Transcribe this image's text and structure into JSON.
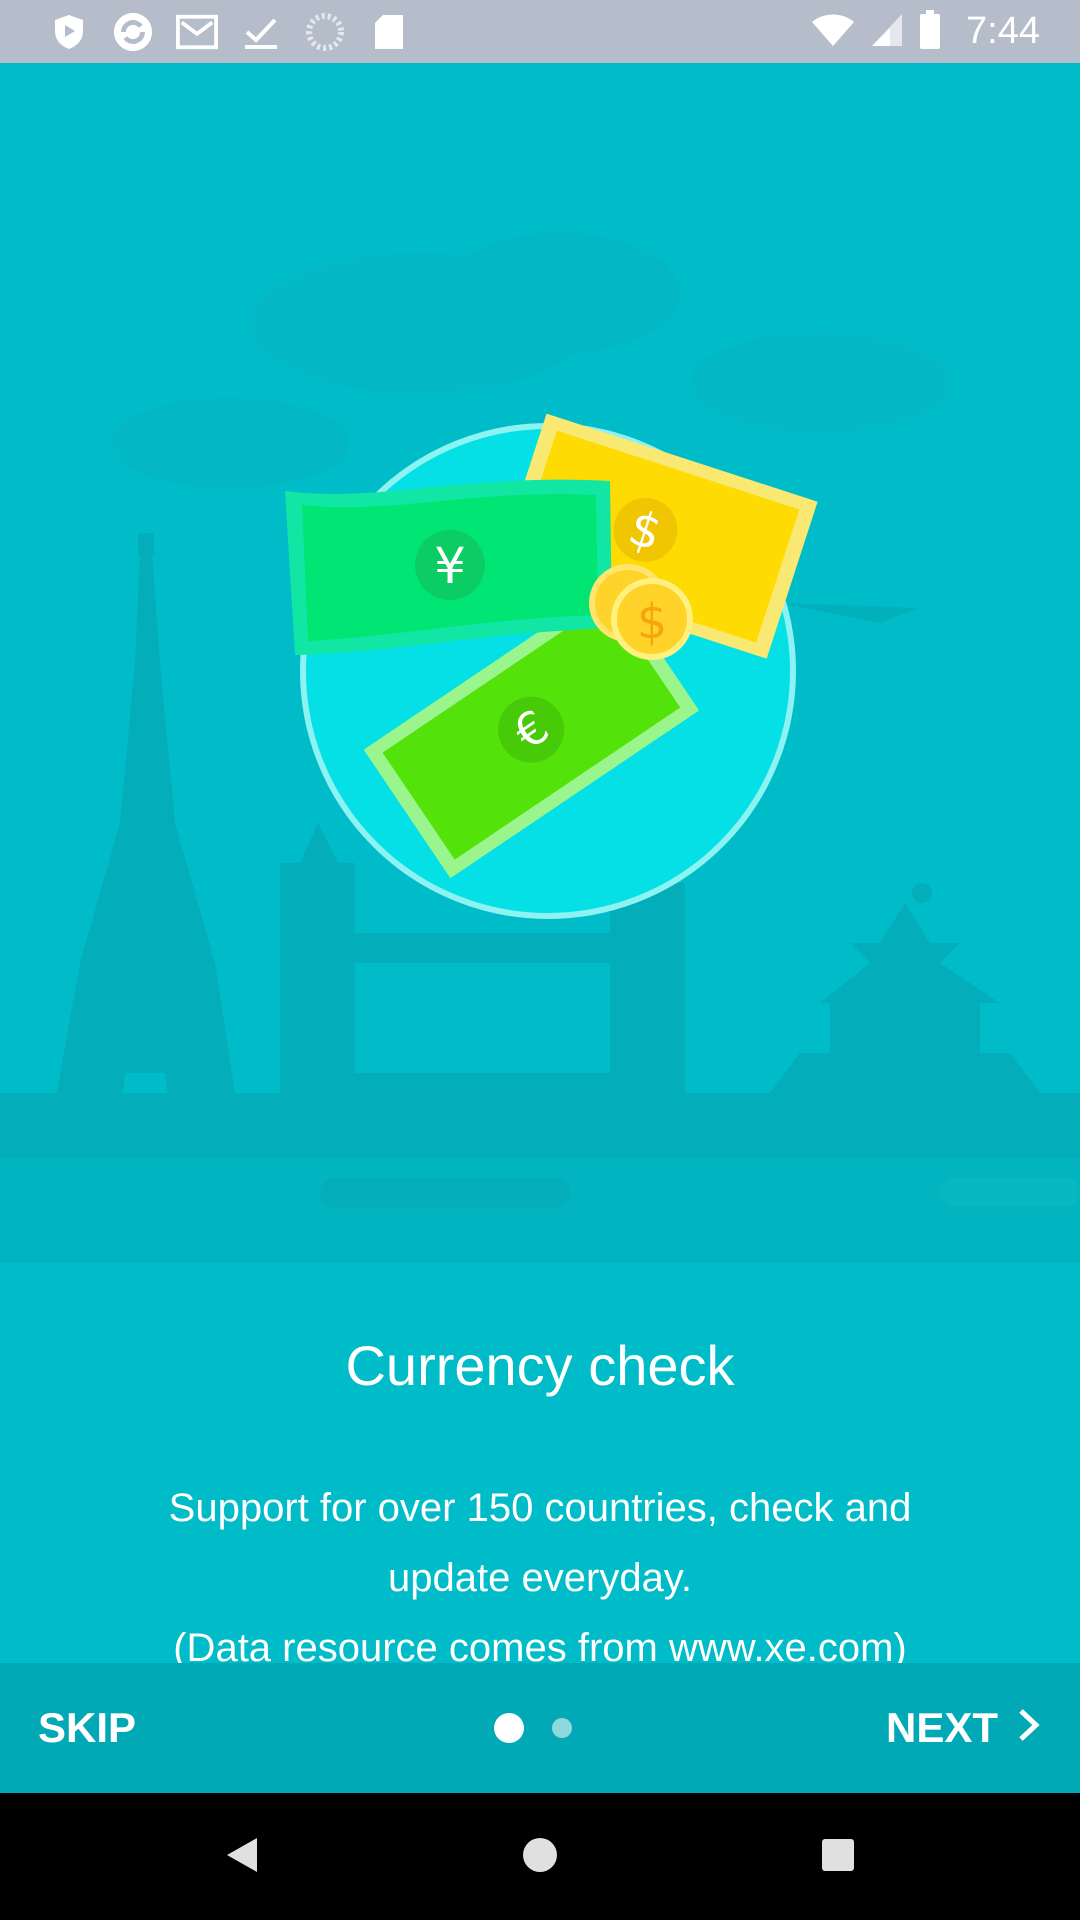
{
  "status_bar": {
    "time": "7:44",
    "left_icons": [
      "shield-icon",
      "sync-icon",
      "mail-icon",
      "check-icon",
      "loading-icon",
      "sd-card-icon"
    ],
    "right_icons": [
      "wifi-icon",
      "signal-icon",
      "battery-icon"
    ]
  },
  "onboarding": {
    "title": "Currency check",
    "description_lines": [
      "Support for over 150 countries, check and",
      "update everyday.",
      "(Data resource comes from www.xe.com)"
    ],
    "illustration_symbols": {
      "yen": "¥",
      "dollar": "$",
      "euro": "€",
      "coin": "$"
    }
  },
  "bottom_bar": {
    "skip_label": "SKIP",
    "next_label": "NEXT",
    "page_count": 2,
    "current_page": 1
  },
  "colors": {
    "background": "#00BCC8",
    "bottom_bar": "#00A9B5",
    "status_bar": "#B5BDCB"
  }
}
